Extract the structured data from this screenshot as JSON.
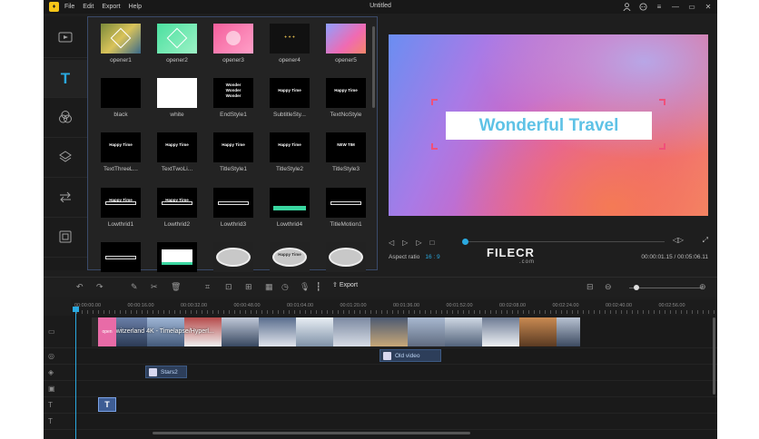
{
  "app": {
    "title": "Untitled",
    "logo": "bird-logo-icon"
  },
  "menu": [
    "File",
    "Edit",
    "Export",
    "Help"
  ],
  "window_controls": [
    "user-icon",
    "feedback-icon",
    "menu-icon",
    "minimize-icon",
    "maximize-icon",
    "close-icon"
  ],
  "rail": [
    {
      "name": "media",
      "icon": "media-icon",
      "glyph": "▭"
    },
    {
      "name": "text",
      "icon": "text-icon",
      "glyph": "T",
      "active": true
    },
    {
      "name": "filters",
      "icon": "filters-icon",
      "glyph": "◎"
    },
    {
      "name": "overlays",
      "icon": "overlays-icon",
      "glyph": "◈"
    },
    {
      "name": "transitions",
      "icon": "transitions-icon",
      "glyph": "⇆"
    },
    {
      "name": "elements",
      "icon": "elements-icon",
      "glyph": "▣"
    }
  ],
  "library": {
    "rows": [
      [
        {
          "label": "opener1",
          "style": "gold"
        },
        {
          "label": "opener2",
          "style": "green"
        },
        {
          "label": "opener3",
          "style": "pink"
        },
        {
          "label": "opener4",
          "style": "darkgold"
        },
        {
          "label": "opener5",
          "style": "gradient"
        }
      ],
      [
        {
          "label": "black",
          "style": "black"
        },
        {
          "label": "white",
          "style": "white"
        },
        {
          "label": "EndStyle1",
          "style": "lines",
          "text": "Wonder\nWonder\nWonder"
        },
        {
          "label": "SubtitleSty...",
          "style": "caption",
          "text": "Happy Time"
        },
        {
          "label": "TextNoStyle",
          "style": "caption",
          "text": "Happy Time"
        }
      ],
      [
        {
          "label": "TextThreeL...",
          "style": "caption",
          "text": "Happy Time"
        },
        {
          "label": "TextTwoLi...",
          "style": "caption",
          "text": "Happy Time"
        },
        {
          "label": "TitleStyle1",
          "style": "caption",
          "text": "Happy Time"
        },
        {
          "label": "TitleStyle2",
          "style": "caption",
          "text": "Happy Time"
        },
        {
          "label": "TitleStyle3",
          "style": "caption",
          "text": "NEW TIM"
        }
      ],
      [
        {
          "label": "Lowthrid1",
          "style": "lower",
          "text": "Happy Time"
        },
        {
          "label": "Lowthrid2",
          "style": "lower",
          "text": "Happy Time"
        },
        {
          "label": "Lowthrid3",
          "style": "lower",
          "text": ""
        },
        {
          "label": "Lowthrid4",
          "style": "lowergreen",
          "text": ""
        },
        {
          "label": "TitleMotion1",
          "style": "lower",
          "text": ""
        }
      ],
      [
        {
          "label": "",
          "style": "lower",
          "text": ""
        },
        {
          "label": "",
          "style": "whitebox",
          "text": ""
        },
        {
          "label": "",
          "style": "oval",
          "text": ""
        },
        {
          "label": "",
          "style": "oval",
          "text": "Happy Time"
        },
        {
          "label": "",
          "style": "oval",
          "text": ""
        }
      ]
    ]
  },
  "preview": {
    "banner_text": "Wonderful Travel",
    "aspect_label": "Aspect ratio",
    "aspect_value": "16 : 9",
    "timecode": "00:00:01.15 / 00:05:06.11",
    "progress": 0.005,
    "controls": [
      "prev-frame-icon",
      "play-icon",
      "next-frame-icon",
      "stop-icon"
    ],
    "right_controls": [
      "snapshot-icon",
      "fullscreen-icon"
    ]
  },
  "watermark": {
    "text": "FILECR",
    "sub": ".com"
  },
  "toolbar": {
    "tools": [
      "undo-icon",
      "redo-icon",
      "pen-icon",
      "cut-icon",
      "delete-icon",
      "crop-icon",
      "zoom-clip-icon",
      "freeze-icon",
      "mosaic-icon",
      "speed-icon",
      "record-icon",
      "audio-icon"
    ],
    "export_label": "Export",
    "zoom_level": 0.1
  },
  "ruler": {
    "labels": [
      "00:00:00.00",
      "00:00:16.00",
      "00:00:32.00",
      "00:00:48.00",
      "00:01:04.00",
      "00:01:20.00",
      "00:01:36.00",
      "00:01:52.00",
      "00:02:08.00",
      "00:02:24.00",
      "00:02:40.00",
      "00:02:56.00"
    ]
  },
  "timeline": {
    "video_clip_title": "Switzerland 4K - Timelapse/Hyperl...",
    "opener_label": "open",
    "effect_clip": "Old video",
    "overlay_clip": "Stars2",
    "text_clip": "T",
    "track_icons": [
      "video-track-icon",
      "filter-track-icon",
      "overlay-track-icon",
      "pip-track-icon",
      "text-track-icon",
      "title-track-icon"
    ]
  }
}
